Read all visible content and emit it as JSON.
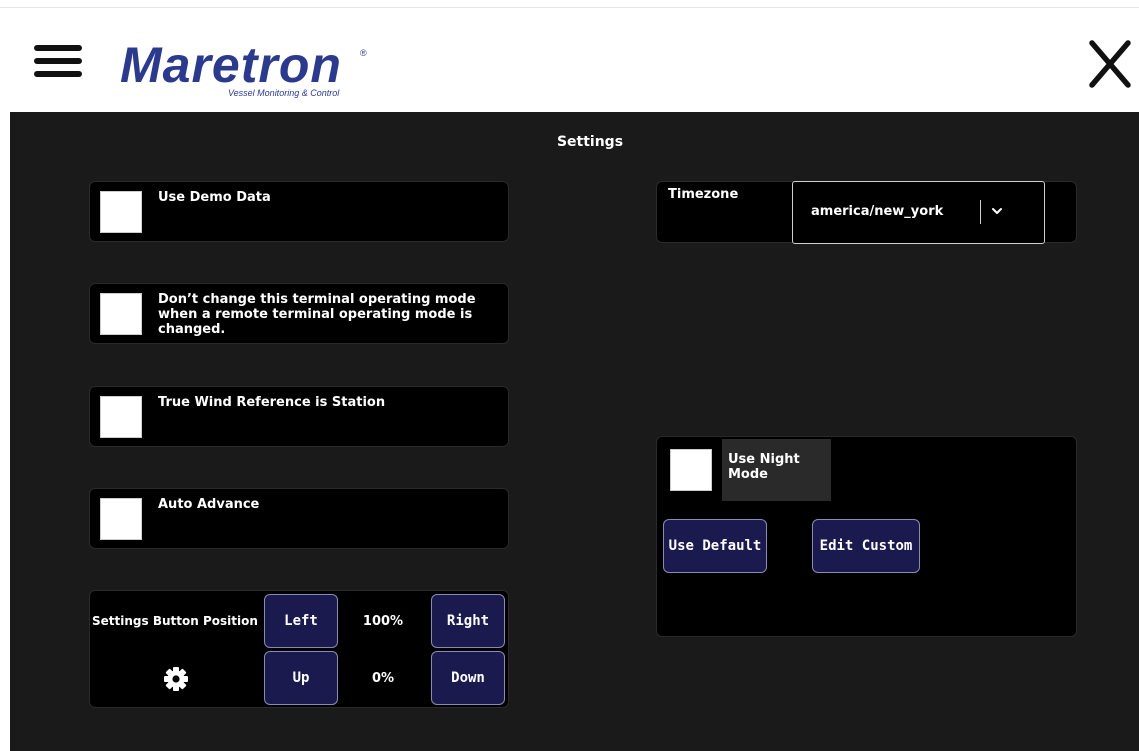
{
  "header": {
    "logo_text": "Maretron",
    "logo_reg": "®",
    "logo_tagline": "Vessel Monitoring & Control",
    "menu_icon": "hamburger-menu-icon",
    "close_icon": "close-x-icon"
  },
  "page": {
    "title": "Settings"
  },
  "options": {
    "demo_data": {
      "label": "Use Demo Data",
      "checked": false
    },
    "terminal_mode": {
      "label": "Don’t change this terminal operating mode when a remote terminal operating mode is changed.",
      "checked": false
    },
    "true_wind": {
      "label": "True Wind Reference is Station",
      "checked": false
    },
    "auto_advance": {
      "label": "Auto Advance",
      "checked": false
    }
  },
  "button_position": {
    "label": "Settings Button Position",
    "icon": "gear-icon",
    "left_label": "Left",
    "right_label": "Right",
    "up_label": "Up",
    "down_label": "Down",
    "horizontal_value": "100%",
    "vertical_value": "0%"
  },
  "timezone": {
    "label": "Timezone",
    "selected": "america/new_york"
  },
  "night_mode": {
    "label": "Use Night Mode",
    "checked": false,
    "use_default_label": "Use Default",
    "edit_custom_label": "Edit Custom"
  },
  "colors": {
    "brand": "#2b3a8c",
    "background": "#1a1a1a",
    "panel": "#000000",
    "button": "#1a1a4e"
  }
}
